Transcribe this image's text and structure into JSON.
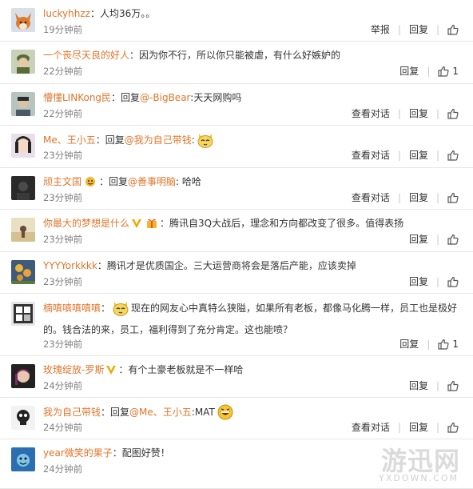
{
  "comments": [
    {
      "avatar": "fox-avatar-icon",
      "segments": [
        {
          "t": "user",
          "v": "luckyhhzz"
        },
        {
          "t": "text",
          "v": "：人均36万。。"
        }
      ],
      "time": "19分钟前",
      "actions": [
        "举报",
        "回复"
      ],
      "likes": ""
    },
    {
      "avatar": "soldier-avatar-icon",
      "segments": [
        {
          "t": "user",
          "v": "一个丧尽天良的好人"
        },
        {
          "t": "text",
          "v": "：因为你不行，所以你只能被虐，有什么好嫉妒的"
        }
      ],
      "time": "22分钟前",
      "actions": [
        "回复"
      ],
      "likes": "1"
    },
    {
      "avatar": "person-avatar-icon",
      "segments": [
        {
          "t": "user",
          "v": "懵懂LINKong民"
        },
        {
          "t": "text",
          "v": "：回复"
        },
        {
          "t": "mention",
          "v": "@-BigBear"
        },
        {
          "t": "text",
          "v": ":天天网购吗"
        }
      ],
      "time": "22分钟前",
      "actions": [
        "查看对话",
        "回复"
      ],
      "likes": ""
    },
    {
      "avatar": "anime-avatar-icon",
      "segments": [
        {
          "t": "user",
          "v": "Me、王小五"
        },
        {
          "t": "text",
          "v": "：回复"
        },
        {
          "t": "mention",
          "v": "@我为自己带钱"
        },
        {
          "t": "text",
          "v": ":"
        },
        {
          "t": "emoji",
          "v": "cat-face-emoji"
        }
      ],
      "time": "23分钟前",
      "actions": [
        "查看对话",
        "回复"
      ],
      "likes": ""
    },
    {
      "avatar": "dark-avatar-icon",
      "segments": [
        {
          "t": "user",
          "v": "顽主文国"
        },
        {
          "t": "badge",
          "v": "fan-badge-icon"
        },
        {
          "t": "text",
          "v": "：回复"
        },
        {
          "t": "mention",
          "v": "@善事明脑"
        },
        {
          "t": "text",
          "v": ": 哈哈"
        }
      ],
      "time": "23分钟前",
      "actions": [
        "查看对话",
        "回复"
      ],
      "likes": ""
    },
    {
      "avatar": "beach-avatar-icon",
      "segments": [
        {
          "t": "user",
          "v": "你最大的梦想是什么"
        },
        {
          "t": "badge",
          "v": "vip-badge-icon"
        },
        {
          "t": "badge",
          "v": "gift-badge-icon"
        },
        {
          "t": "text",
          "v": "：腾讯自3Q大战后，理念和方向都改变了很多。值得表扬"
        }
      ],
      "time": "23分钟前",
      "actions": [
        "回复"
      ],
      "likes": ""
    },
    {
      "avatar": "flower-avatar-icon",
      "segments": [
        {
          "t": "user",
          "v": "YYYYorkkkk"
        },
        {
          "t": "text",
          "v": "：腾讯才是优质国企。三大运营商将会是落后产能，应该卖掉"
        }
      ],
      "time": "23分钟前",
      "actions": [
        "回复"
      ],
      "likes": ""
    },
    {
      "avatar": "window-avatar-icon",
      "segments": [
        {
          "t": "user",
          "v": "楠嗔嗔嗔嗔嗔"
        },
        {
          "t": "text",
          "v": "："
        },
        {
          "t": "emoji",
          "v": "cat-face-emoji"
        },
        {
          "t": "text",
          "v": "现在的网友心中真特么狭隘，如果所有老板，都像马化腾一样，员工也是极好的。钱合法的来，员工，福利得到了充分肯定。这也能喷？"
        }
      ],
      "time": "23分钟前",
      "actions": [
        "回复"
      ],
      "likes": "1",
      "multiline": true
    },
    {
      "avatar": "girl-avatar-icon",
      "segments": [
        {
          "t": "user",
          "v": "玫瑰绽放-罗斯"
        },
        {
          "t": "badge",
          "v": "vip-badge-icon"
        },
        {
          "t": "text",
          "v": "：有个土豪老板就是不一样哈"
        }
      ],
      "time": "24分钟前",
      "actions": [
        "回复"
      ],
      "likes": ""
    },
    {
      "avatar": "skull-avatar-icon",
      "segments": [
        {
          "t": "user",
          "v": "我为自己带钱"
        },
        {
          "t": "text",
          "v": "：回复"
        },
        {
          "t": "mention",
          "v": "@Me、王小五"
        },
        {
          "t": "text",
          "v": ":MAT"
        },
        {
          "t": "emoji",
          "v": "laugh-face-emoji"
        }
      ],
      "time": "24分钟前",
      "actions": [
        "查看对话",
        "回复"
      ],
      "likes": ""
    },
    {
      "avatar": "cartoon-avatar-icon",
      "segments": [
        {
          "t": "user",
          "v": "year微笑的果子"
        },
        {
          "t": "text",
          "v": "：配图好赞！"
        }
      ],
      "time": "24分钟前",
      "actions": [],
      "likes": ""
    }
  ],
  "watermark": {
    "main": "游迅网",
    "sub": "YXDOWN.COM"
  },
  "colors": {
    "username": "#e0752b",
    "text": "#333333",
    "time": "#808080",
    "divider": "#e6e6e6"
  }
}
